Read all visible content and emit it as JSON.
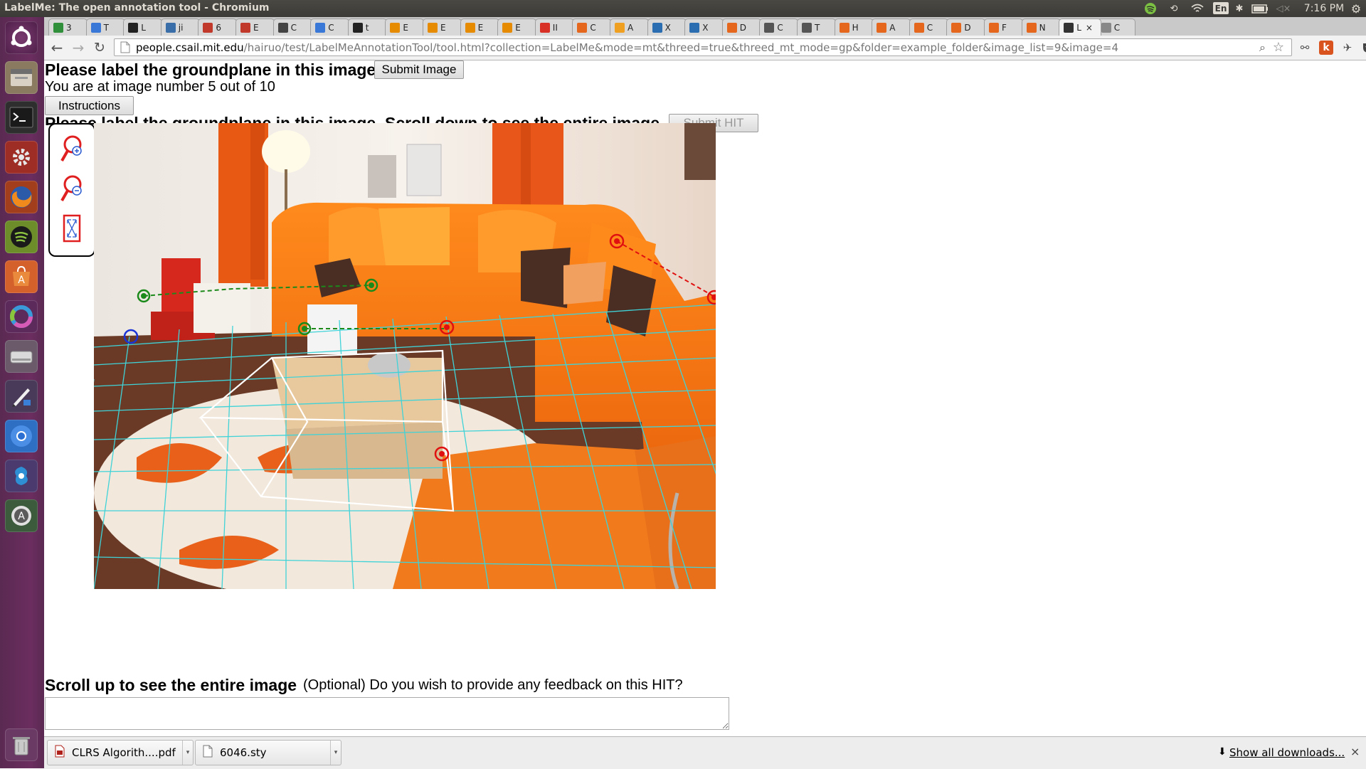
{
  "topbar": {
    "title": "LabelMe: The open annotation tool - Chromium",
    "keyboard": "En",
    "time": "7:16 PM"
  },
  "tabs": [
    {
      "label": "3",
      "icon": "drive-icon",
      "color": "#2f8f3a"
    },
    {
      "label": "T",
      "icon": "doc-icon",
      "color": "#3a78d8"
    },
    {
      "label": "L",
      "icon": "github-icon",
      "color": "#222222"
    },
    {
      "label": "ji",
      "icon": "jira-icon",
      "color": "#3a6ea8"
    },
    {
      "label": "6",
      "icon": "flag-icon",
      "color": "#c0392b"
    },
    {
      "label": "E",
      "icon": "flag-icon",
      "color": "#c0392b"
    },
    {
      "label": "C",
      "icon": "bee-icon",
      "color": "#444444"
    },
    {
      "label": "C",
      "icon": "doc-icon",
      "color": "#3a78d8"
    },
    {
      "label": "t",
      "icon": "github-icon",
      "color": "#222222"
    },
    {
      "label": "E",
      "icon": "w-icon",
      "color": "#e68a00"
    },
    {
      "label": "E",
      "icon": "w-icon",
      "color": "#e68a00"
    },
    {
      "label": "E",
      "icon": "w-icon",
      "color": "#e68a00"
    },
    {
      "label": "E",
      "icon": "w-icon",
      "color": "#e68a00"
    },
    {
      "label": "II",
      "icon": "gmail-icon",
      "color": "#d93025"
    },
    {
      "label": "C",
      "icon": "matlab-icon",
      "color": "#e5671e"
    },
    {
      "label": "A",
      "icon": "circle-icon",
      "color": "#f0a020"
    },
    {
      "label": "X",
      "icon": "w3-icon",
      "color": "#2a6db0"
    },
    {
      "label": "X",
      "icon": "w3-icon",
      "color": "#2a6db0"
    },
    {
      "label": "D",
      "icon": "matlab-icon",
      "color": "#e5671e"
    },
    {
      "label": "C",
      "icon": "wiki-icon",
      "color": "#555555"
    },
    {
      "label": "T",
      "icon": "wiki-icon",
      "color": "#555555"
    },
    {
      "label": "H",
      "icon": "matlab-icon",
      "color": "#e5671e"
    },
    {
      "label": "A",
      "icon": "matlab-icon",
      "color": "#e5671e"
    },
    {
      "label": "C",
      "icon": "matlab-icon",
      "color": "#e5671e"
    },
    {
      "label": "D",
      "icon": "matlab-icon",
      "color": "#e5671e"
    },
    {
      "label": "F",
      "icon": "matlab-icon",
      "color": "#e5671e"
    },
    {
      "label": "N",
      "icon": "matlab-icon",
      "color": "#e5671e"
    },
    {
      "label": "L",
      "icon": "labelme-icon",
      "color": "#333333",
      "active": true,
      "close": "×"
    },
    {
      "label": "C",
      "icon": "page-icon",
      "color": "#888888"
    }
  ],
  "url": {
    "host": "people.csail.mit.edu",
    "path": "/hairuo/test/LabelMeAnnotationTool/tool.html?collection=LabelMe&mode=mt&threed=true&threed_mt_mode=gp&folder=example_folder&image_list=9&image=4"
  },
  "page": {
    "heading": "Please label the groundplane in this image.",
    "submit_image": "Submit Image",
    "image_counter": "You are at image number 5 out of 10",
    "instructions_button": "Instructions",
    "heading2": "Please label the groundplane in this image. Scroll down to see the entire image.",
    "submit_hit": "Submit HIT",
    "scroll_up": "Scroll up to see the entire image",
    "feedback_prompt": "(Optional) Do you wish to provide any feedback on this HIT?"
  },
  "tools": [
    {
      "name": "zoom-in-icon"
    },
    {
      "name": "zoom-out-icon"
    },
    {
      "name": "fit-image-icon"
    }
  ],
  "downloads": {
    "items": [
      {
        "label": "CLRS Algorith....pdf",
        "icon": "pdf-icon"
      },
      {
        "label": "6046.sty",
        "icon": "file-icon"
      }
    ],
    "show_all": "Show all downloads...",
    "close": "×"
  },
  "colors": {
    "accent_orange": "#f36f10",
    "grid_cyan": "#3fd3d8",
    "point_red": "#e01010",
    "point_green": "#1b8a1b",
    "point_blue": "#1a33d6",
    "launcher_purple": "#6b2d5f"
  }
}
